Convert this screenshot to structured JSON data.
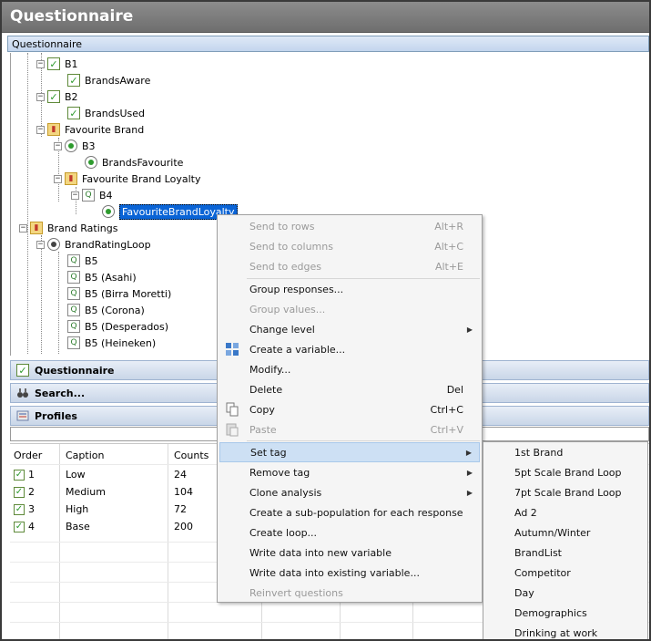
{
  "window": {
    "title": "Questionnaire"
  },
  "tree_panel": {
    "header": "Questionnaire"
  },
  "tree": {
    "b1": "B1",
    "brands_aware": "BrandsAware",
    "b2": "B2",
    "brands_used": "BrandsUsed",
    "favourite_brand": "Favourite Brand",
    "b3": "B3",
    "brands_favourite": "BrandsFavourite",
    "favourite_brand_loyalty": "Favourite Brand Loyalty",
    "b4": "B4",
    "favourite_brand_loyalty_var": "FavouriteBrandLoyalty",
    "brand_ratings": "Brand Ratings",
    "brand_rating_loop": "BrandRatingLoop",
    "b5": "B5",
    "b5_asahi": "B5 (Asahi)",
    "b5_birra": "B5 (Birra Moretti)",
    "b5_corona": "B5 (Corona)",
    "b5_desperados": "B5 (Desperados)",
    "b5_heineken": "B5 (Heineken)"
  },
  "bars": {
    "questionnaire": "Questionnaire",
    "search": "Search...",
    "profiles": "Profiles"
  },
  "grid": {
    "columns": [
      "Order",
      "Caption",
      "Counts"
    ],
    "rows": [
      {
        "order": "1",
        "caption": "Low",
        "counts": "24"
      },
      {
        "order": "2",
        "caption": "Medium",
        "counts": "104"
      },
      {
        "order": "3",
        "caption": "High",
        "counts": "72"
      },
      {
        "order": "4",
        "caption": "Base",
        "counts": "200"
      }
    ]
  },
  "context_menu": {
    "send_rows": {
      "label": "Send to rows",
      "shortcut": "Alt+R"
    },
    "send_columns": {
      "label": "Send to columns",
      "shortcut": "Alt+C"
    },
    "send_edges": {
      "label": "Send to edges",
      "shortcut": "Alt+E"
    },
    "group_responses": "Group responses...",
    "group_values": "Group values...",
    "change_level": "Change level",
    "create_variable": "Create a variable...",
    "modify": "Modify...",
    "delete": {
      "label": "Delete",
      "shortcut": "Del"
    },
    "copy": {
      "label": "Copy",
      "shortcut": "Ctrl+C"
    },
    "paste": {
      "label": "Paste",
      "shortcut": "Ctrl+V"
    },
    "set_tag": "Set tag",
    "remove_tag": "Remove tag",
    "clone_analysis": "Clone analysis",
    "create_subpop": "Create a sub-population for each response",
    "create_loop": "Create loop...",
    "write_new": "Write data into new variable",
    "write_existing": "Write data into existing variable...",
    "reinvert": "Reinvert questions"
  },
  "tag_submenu": [
    "1st Brand",
    "5pt Scale Brand Loop",
    "7pt Scale Brand Loop",
    "Ad 2",
    "Autumn/Winter",
    "BrandList",
    "Competitor",
    "Day",
    "Demographics",
    "Drinking at work"
  ]
}
